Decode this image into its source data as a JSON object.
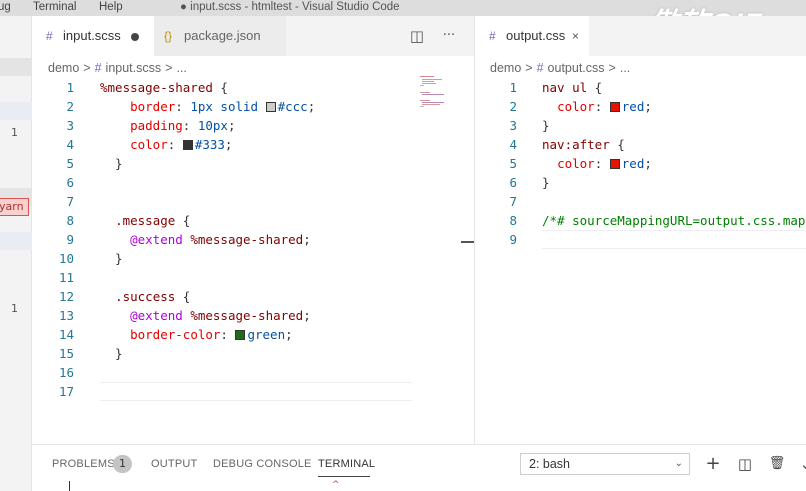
{
  "menu": {
    "items": [
      "ug",
      "Terminal",
      "Help"
    ]
  },
  "window_title": "● input.scss - htmltest - Visual Studio Code",
  "watermark": "傲软GIF",
  "sidebar": {
    "count_a": "1",
    "count_b": "1",
    "yarn_label": "yarn"
  },
  "left_group": {
    "tabs": [
      {
        "icon": "#",
        "label": "input.scss",
        "dirty": true
      },
      {
        "icon": "{}",
        "label": "package.json"
      }
    ],
    "actions": {
      "split": "◫",
      "more": "···"
    },
    "breadcrumb": [
      "demo",
      ">",
      "#",
      "input.scss",
      ">",
      "..."
    ],
    "lines": [
      {
        "n": "1",
        "tokens": [
          [
            "sel",
            "%message-shared"
          ],
          [
            "punc",
            " {"
          ]
        ]
      },
      {
        "n": "2",
        "tokens": [
          [
            "punc",
            "    "
          ],
          [
            "prop",
            "border"
          ],
          [
            "punc",
            ": "
          ],
          [
            "val",
            "1px solid "
          ],
          [
            "sw",
            "#cccccc"
          ],
          [
            "val",
            "#ccc"
          ],
          [
            "punc",
            ";"
          ]
        ]
      },
      {
        "n": "3",
        "tokens": [
          [
            "punc",
            "    "
          ],
          [
            "prop",
            "padding"
          ],
          [
            "punc",
            ": "
          ],
          [
            "val",
            "10px"
          ],
          [
            "punc",
            ";"
          ]
        ]
      },
      {
        "n": "4",
        "tokens": [
          [
            "punc",
            "    "
          ],
          [
            "prop",
            "color"
          ],
          [
            "punc",
            ": "
          ],
          [
            "sw",
            "#333333"
          ],
          [
            "val",
            "#333"
          ],
          [
            "punc",
            ";"
          ]
        ]
      },
      {
        "n": "5",
        "tokens": [
          [
            "punc",
            "  }"
          ]
        ]
      },
      {
        "n": "6",
        "tokens": []
      },
      {
        "n": "7",
        "tokens": []
      },
      {
        "n": "8",
        "tokens": [
          [
            "punc",
            "  "
          ],
          [
            "sel",
            ".message"
          ],
          [
            "punc",
            " {"
          ]
        ]
      },
      {
        "n": "9",
        "tokens": [
          [
            "punc",
            "    "
          ],
          [
            "at",
            "@extend"
          ],
          [
            "punc",
            " "
          ],
          [
            "sel",
            "%message-shared"
          ],
          [
            "punc",
            ";"
          ]
        ]
      },
      {
        "n": "10",
        "tokens": [
          [
            "punc",
            "  }"
          ]
        ]
      },
      {
        "n": "11",
        "tokens": []
      },
      {
        "n": "12",
        "tokens": [
          [
            "punc",
            "  "
          ],
          [
            "sel",
            ".success"
          ],
          [
            "punc",
            " {"
          ]
        ]
      },
      {
        "n": "13",
        "tokens": [
          [
            "punc",
            "    "
          ],
          [
            "at",
            "@extend"
          ],
          [
            "punc",
            " "
          ],
          [
            "sel",
            "%message-shared"
          ],
          [
            "punc",
            ";"
          ]
        ]
      },
      {
        "n": "14",
        "tokens": [
          [
            "punc",
            "    "
          ],
          [
            "prop",
            "border-color"
          ],
          [
            "punc",
            ": "
          ],
          [
            "sw",
            "#1e6b1e"
          ],
          [
            "val",
            "green"
          ],
          [
            "punc",
            ";"
          ]
        ]
      },
      {
        "n": "15",
        "tokens": [
          [
            "punc",
            "  }"
          ]
        ]
      },
      {
        "n": "16",
        "tokens": []
      },
      {
        "n": "17",
        "tokens": []
      }
    ]
  },
  "right_group": {
    "tabs": [
      {
        "icon": "#",
        "label": "output.css",
        "close": "×"
      }
    ],
    "breadcrumb": [
      "demo",
      ">",
      "#",
      "output.css",
      ">",
      "..."
    ],
    "lines": [
      {
        "n": "1",
        "tokens": [
          [
            "sel",
            "nav ul"
          ],
          [
            "punc",
            " {"
          ]
        ]
      },
      {
        "n": "2",
        "tokens": [
          [
            "punc",
            "  "
          ],
          [
            "prop",
            "color"
          ],
          [
            "punc",
            ": "
          ],
          [
            "sw",
            "#e51400"
          ],
          [
            "val",
            "red"
          ],
          [
            "punc",
            ";"
          ]
        ]
      },
      {
        "n": "3",
        "tokens": [
          [
            "punc",
            "}"
          ]
        ]
      },
      {
        "n": "4",
        "tokens": [
          [
            "sel",
            "nav:after"
          ],
          [
            "punc",
            " {"
          ]
        ]
      },
      {
        "n": "5",
        "tokens": [
          [
            "punc",
            "  "
          ],
          [
            "prop",
            "color"
          ],
          [
            "punc",
            ": "
          ],
          [
            "sw",
            "#e51400"
          ],
          [
            "val",
            "red"
          ],
          [
            "punc",
            ";"
          ]
        ]
      },
      {
        "n": "6",
        "tokens": [
          [
            "punc",
            "}"
          ]
        ]
      },
      {
        "n": "7",
        "tokens": []
      },
      {
        "n": "8",
        "tokens": [
          [
            "cmt",
            "/*# sourceMappingURL=output.css.map */"
          ]
        ]
      },
      {
        "n": "9",
        "tokens": []
      }
    ]
  },
  "panel": {
    "tabs": [
      "PROBLEMS",
      "OUTPUT",
      "DEBUG CONSOLE",
      "TERMINAL"
    ],
    "problems_count": "1",
    "terminal_select": "2: bash",
    "chevron": "⌄",
    "icons": {
      "add": "+",
      "split": "◫",
      "trash": "🗑",
      "more": "⌄"
    },
    "caret": "^"
  }
}
